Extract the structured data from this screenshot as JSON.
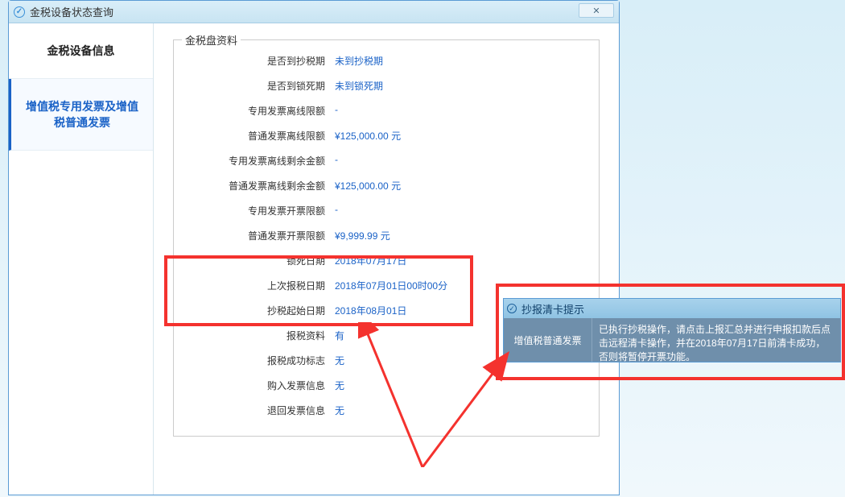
{
  "window": {
    "title": "金税设备状态查询",
    "close_label": "✕"
  },
  "sidebar": {
    "items": [
      {
        "label": "金税设备信息"
      },
      {
        "label": "增值税专用发票及增值税普通发票"
      }
    ]
  },
  "fieldset": {
    "legend": "金税盘资料",
    "rows": [
      {
        "label": "是否到抄税期",
        "value": "未到抄税期"
      },
      {
        "label": "是否到锁死期",
        "value": "未到锁死期"
      },
      {
        "label": "专用发票离线限额",
        "value": "-"
      },
      {
        "label": "普通发票离线限额",
        "value": "¥125,000.00 元"
      },
      {
        "label": "专用发票离线剩余金额",
        "value": "-"
      },
      {
        "label": "普通发票离线剩余金额",
        "value": "¥125,000.00 元"
      },
      {
        "label": "专用发票开票限额",
        "value": "-"
      },
      {
        "label": "普通发票开票限额",
        "value": "¥9,999.99 元"
      },
      {
        "label": "锁死日期",
        "value": "2018年07月17日"
      },
      {
        "label": "上次报税日期",
        "value": "2018年07月01日00时00分"
      },
      {
        "label": "抄税起始日期",
        "value": "2018年08月01日"
      },
      {
        "label": "报税资料",
        "value": "有"
      },
      {
        "label": "报税成功标志",
        "value": "无"
      },
      {
        "label": "购入发票信息",
        "value": "无"
      },
      {
        "label": "退回发票信息",
        "value": "无"
      }
    ]
  },
  "popup": {
    "title": "抄报清卡提示",
    "col1": "增值税普通发票",
    "col2": "已执行抄税操作，请点击上报汇总并进行申报扣款后点击远程清卡操作，并在2018年07月17日前清卡成功，否则将暂停开票功能。"
  }
}
